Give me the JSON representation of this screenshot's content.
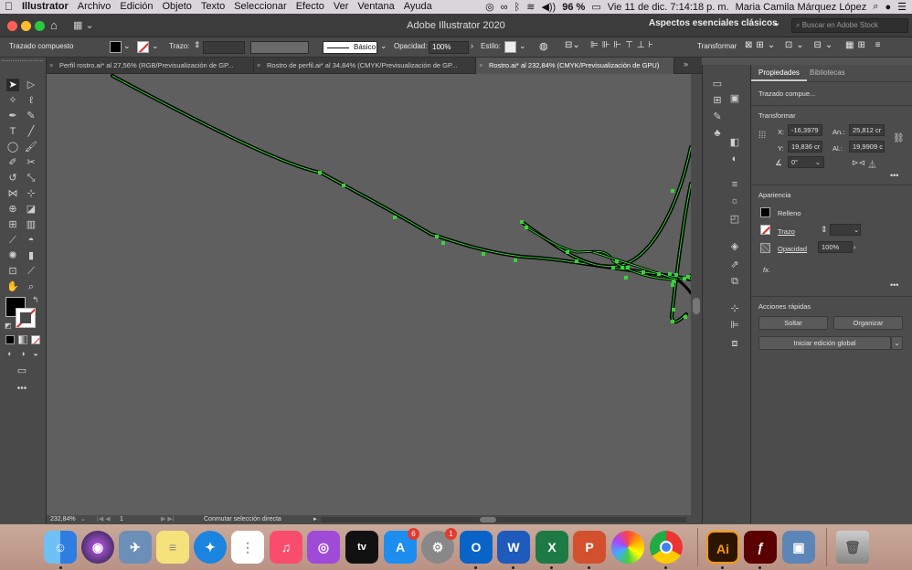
{
  "menubar": {
    "app": "Illustrator",
    "items": [
      "Archivo",
      "Edición",
      "Objeto",
      "Texto",
      "Seleccionar",
      "Efecto",
      "Ver",
      "Ventana",
      "Ayuda"
    ],
    "battery": "96 %",
    "datetime": "Vie 11 de dic.  7:14:18 p. m.",
    "user": "Maria Camila Márquez López"
  },
  "titlebar": {
    "title": "Adobe Illustrator 2020",
    "workspace": "Aspectos esenciales clásicos",
    "search_placeholder": "Buscar en Adobe Stock"
  },
  "control": {
    "selection": "Trazado compuesto",
    "stroke_label": "Trazo:",
    "brush": "Básico",
    "opacity_label": "Opacidad:",
    "opacity": "100%",
    "style_label": "Estilo:",
    "transform_label": "Transformar"
  },
  "tabs": [
    {
      "label": "Perfil rostro.ai* al 27,56% (RGB/Previsualización de GP...",
      "active": false
    },
    {
      "label": "Rostro de perfil.ai* al 34,84% (CMYK/Previsualización de GP...",
      "active": false
    },
    {
      "label": "Rostro.ai* al 232,84% (CMYK/Previsualización de GPU)",
      "active": true
    }
  ],
  "status": {
    "zoom": "232,84%",
    "artboard": "1",
    "hint": "Conmutar selección directa"
  },
  "properties": {
    "tab_props": "Propiedades",
    "tab_libs": "Bibliotecas",
    "object": "Trazado compue...",
    "transform_title": "Transformar",
    "x_label": "X:",
    "x": "-16,3979",
    "y_label": "Y:",
    "y": "19,836 cr",
    "w_label": "An.:",
    "w": "25,812 cr",
    "h_label": "Al.:",
    "h": "19,9909 c",
    "angle": "0°",
    "appearance_title": "Apariencia",
    "fill_label": "Relleno",
    "stroke_label": "Trazo",
    "opacity_label": "Opacidad",
    "opacity": "100%",
    "fx": "fx.",
    "quick_title": "Acciones rápidas",
    "btn_release": "Soltar",
    "btn_arrange": "Organizar",
    "btn_global": "Iniciar edición global"
  },
  "dock": {
    "badges": {
      "appstore": "6",
      "prefs": "1"
    },
    "apps": [
      "Finder",
      "Siri",
      "Preview",
      "Notes",
      "Safari",
      "Reminders",
      "Music",
      "Podcasts",
      "TV",
      "App Store",
      "System Preferences",
      "Outlook",
      "Word",
      "Excel",
      "PowerPoint",
      "Photos",
      "Chrome",
      "Illustrator",
      "Flash",
      "Preview",
      "Trash"
    ]
  },
  "colors": {
    "accent": "#2d7ee0",
    "path_highlight": "#39d439"
  }
}
